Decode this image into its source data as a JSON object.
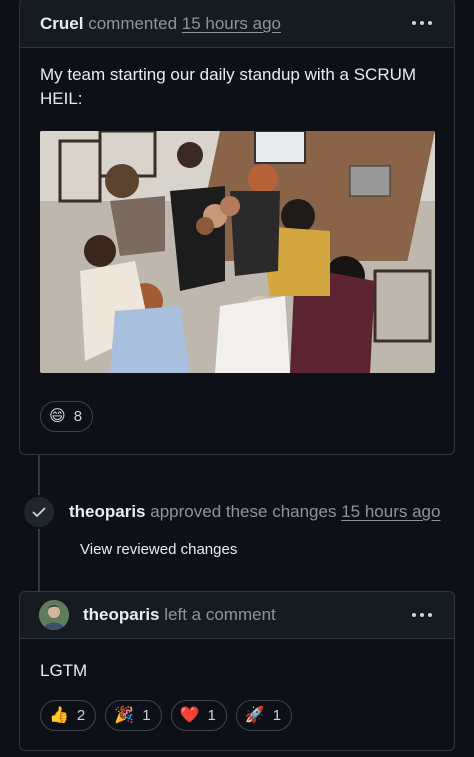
{
  "first_comment": {
    "author": "Cruel",
    "action": "commented",
    "timestamp": "15 hours ago",
    "body": "My team starting our daily standup with a SCRUM HEIL:",
    "reactions": [
      {
        "emoji": "😄",
        "count": "8"
      }
    ]
  },
  "review_event": {
    "author": "theoparis",
    "action": "approved these changes",
    "timestamp": "15 hours ago",
    "link_label": "View reviewed changes"
  },
  "second_comment": {
    "author": "theoparis",
    "action": "left a comment",
    "body": "LGTM",
    "reactions": [
      {
        "emoji": "👍",
        "count": "2"
      },
      {
        "emoji": "🎉",
        "count": "1"
      },
      {
        "emoji": "❤️",
        "count": "1"
      },
      {
        "emoji": "🚀",
        "count": "1"
      }
    ]
  },
  "icons": {
    "more": "kebab-horizontal-icon",
    "approved": "check-icon"
  }
}
